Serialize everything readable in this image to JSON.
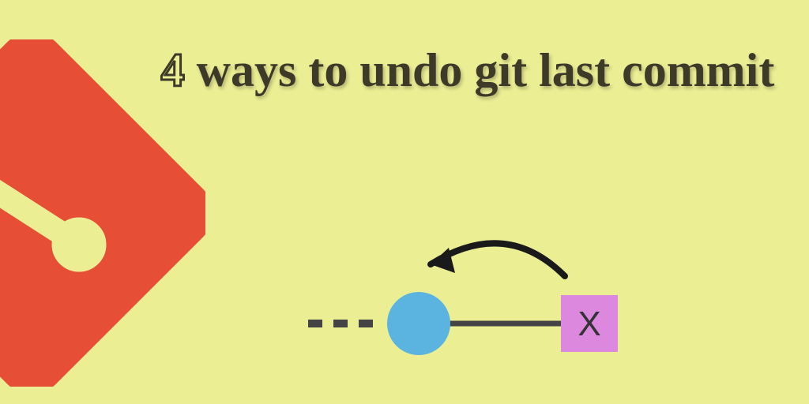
{
  "title": {
    "number": "4",
    "rest": " ways to undo git last commit"
  },
  "diagram": {
    "delete_label": "X"
  },
  "colors": {
    "bg": "#ecee94",
    "git_red": "#e64e36",
    "text": "#3d3a29",
    "circle": "#5bb4e0",
    "square": "#db88de",
    "line": "#444444",
    "arrow": "#1a1a1a"
  }
}
